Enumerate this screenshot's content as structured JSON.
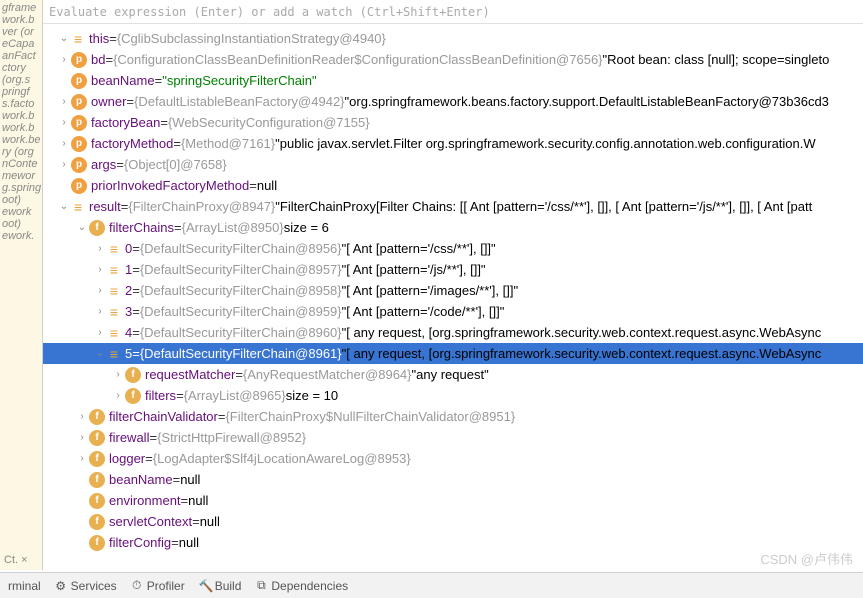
{
  "eval_placeholder": "Evaluate expression (Enter) or add a watch (Ctrl+Shift+Enter)",
  "left_pane_items": [
    "gframe",
    "work.b",
    "ver (or",
    "eCapa",
    "anFact",
    "ctory",
    "(org.s",
    "pringf",
    "s.facto",
    "work.b",
    "work.b",
    "work.be",
    "ry (org",
    "nConte",
    "mewor",
    "g.spring",
    "oot)",
    "ework",
    "oot)",
    "ework."
  ],
  "rows": [
    {
      "indent": 0,
      "arrow": "open",
      "icon": "equals",
      "name": "this",
      "eq": " = ",
      "gray": "{CglibSubclassingInstantiationStrategy@4940}"
    },
    {
      "indent": 0,
      "arrow": "closed",
      "icon": "p",
      "name": "bd",
      "eq": " = ",
      "gray": "{ConfigurationClassBeanDefinitionReader$ConfigurationClassBeanDefinition@7656} ",
      "tail": "\"Root bean: class [null]; scope=singleto"
    },
    {
      "indent": 0,
      "arrow": "",
      "icon": "p",
      "name": "beanName",
      "eq": " = ",
      "str": "\"springSecurityFilterChain\""
    },
    {
      "indent": 0,
      "arrow": "closed",
      "icon": "p",
      "name": "owner",
      "eq": " = ",
      "gray": "{DefaultListableBeanFactory@4942} ",
      "tail": "\"org.springframework.beans.factory.support.DefaultListableBeanFactory@73b36cd3"
    },
    {
      "indent": 0,
      "arrow": "closed",
      "icon": "p",
      "name": "factoryBean",
      "eq": " = ",
      "gray": "{WebSecurityConfiguration@7155}"
    },
    {
      "indent": 0,
      "arrow": "closed",
      "icon": "p",
      "name": "factoryMethod",
      "eq": " = ",
      "gray": "{Method@7161} ",
      "tail": "\"public javax.servlet.Filter org.springframework.security.config.annotation.web.configuration.W"
    },
    {
      "indent": 0,
      "arrow": "closed",
      "icon": "p",
      "name": "args",
      "eq": " = ",
      "gray": "{Object[0]@7658}"
    },
    {
      "indent": 0,
      "arrow": "",
      "icon": "p",
      "name": "priorInvokedFactoryMethod",
      "eq": " = ",
      "black": "null"
    },
    {
      "indent": 0,
      "arrow": "open",
      "icon": "equals",
      "name": "result",
      "eq": " = ",
      "gray": "{FilterChainProxy@8947} ",
      "tail": "\"FilterChainProxy[Filter Chains: [[ Ant [pattern='/css/**'], []], [ Ant [pattern='/js/**'], []], [ Ant [patt"
    },
    {
      "indent": 1,
      "arrow": "open",
      "icon": "f",
      "name": "filterChains",
      "eq": " = ",
      "gray": "{ArrayList@8950}",
      "black": "  size = 6"
    },
    {
      "indent": 2,
      "arrow": "closed",
      "icon": "equals",
      "name": "0",
      "eq": " = ",
      "gray": "{DefaultSecurityFilterChain@8956} ",
      "tail": "\"[ Ant [pattern='/css/**'], []]\""
    },
    {
      "indent": 2,
      "arrow": "closed",
      "icon": "equals",
      "name": "1",
      "eq": " = ",
      "gray": "{DefaultSecurityFilterChain@8957} ",
      "tail": "\"[ Ant [pattern='/js/**'], []]\""
    },
    {
      "indent": 2,
      "arrow": "closed",
      "icon": "equals",
      "name": "2",
      "eq": " = ",
      "gray": "{DefaultSecurityFilterChain@8958} ",
      "tail": "\"[ Ant [pattern='/images/**'], []]\""
    },
    {
      "indent": 2,
      "arrow": "closed",
      "icon": "equals",
      "name": "3",
      "eq": " = ",
      "gray": "{DefaultSecurityFilterChain@8959} ",
      "tail": "\"[ Ant [pattern='/code/**'], []]\""
    },
    {
      "indent": 2,
      "arrow": "closed",
      "icon": "equals",
      "name": "4",
      "eq": " = ",
      "gray": "{DefaultSecurityFilterChain@8960} ",
      "tail": "\"[ any request, [org.springframework.security.web.context.request.async.WebAsync"
    },
    {
      "indent": 2,
      "arrow": "open",
      "icon": "equals",
      "name": "5",
      "eq": " = ",
      "gray": "{DefaultSecurityFilterChain@8961} ",
      "tail": "\"[ any request, [org.springframework.security.web.context.request.async.WebAsync",
      "selected": true
    },
    {
      "indent": 3,
      "arrow": "closed",
      "icon": "f",
      "name": "requestMatcher",
      "eq": " = ",
      "gray": "{AnyRequestMatcher@8964} ",
      "tail": "\"any request\""
    },
    {
      "indent": 3,
      "arrow": "closed",
      "icon": "f",
      "name": "filters",
      "eq": " = ",
      "gray": "{ArrayList@8965}",
      "black": "  size = 10"
    },
    {
      "indent": 1,
      "arrow": "closed",
      "icon": "f",
      "name": "filterChainValidator",
      "eq": " = ",
      "gray": "{FilterChainProxy$NullFilterChainValidator@8951}"
    },
    {
      "indent": 1,
      "arrow": "closed",
      "icon": "f",
      "name": "firewall",
      "eq": " = ",
      "gray": "{StrictHttpFirewall@8952}"
    },
    {
      "indent": 1,
      "arrow": "closed",
      "icon": "f",
      "name": "logger",
      "eq": " = ",
      "gray": "{LogAdapter$Slf4jLocationAwareLog@8953}"
    },
    {
      "indent": 1,
      "arrow": "",
      "icon": "f",
      "name": "beanName",
      "eq": " = ",
      "black": "null"
    },
    {
      "indent": 1,
      "arrow": "",
      "icon": "f",
      "name": "environment",
      "eq": " = ",
      "black": "null"
    },
    {
      "indent": 1,
      "arrow": "",
      "icon": "f",
      "name": "servletContext",
      "eq": " = ",
      "black": "null"
    },
    {
      "indent": 1,
      "arrow": "",
      "icon": "f",
      "name": "filterConfig",
      "eq": " = ",
      "black": "null"
    }
  ],
  "structure_tab": "Ct. ×",
  "bottom_tabs": [
    "rminal",
    "Services",
    "Profiler",
    "Build",
    "Dependencies"
  ],
  "watermark": "CSDN @卢伟伟"
}
